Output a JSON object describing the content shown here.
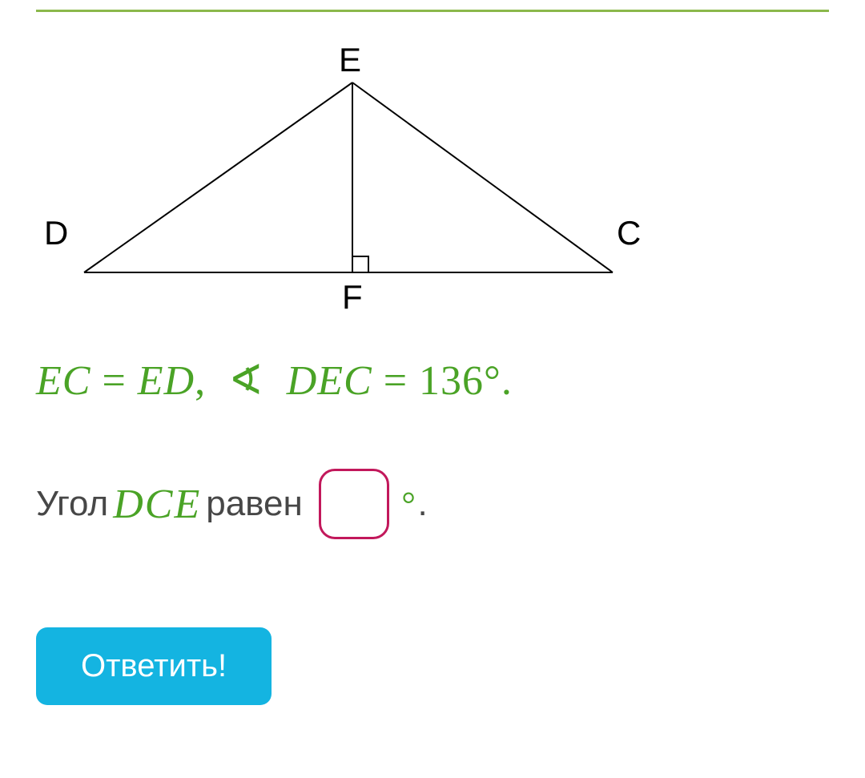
{
  "diagram": {
    "labels": {
      "E": "E",
      "D": "D",
      "C": "C",
      "F": "F"
    }
  },
  "given": {
    "seg1": "EC",
    "eq1": "=",
    "seg2": "ED",
    "comma": ",",
    "angle_sym": "∢",
    "angle_name": "DEC",
    "eq2": "=",
    "angle_val": "136",
    "deg": "°",
    "period": "."
  },
  "question": {
    "word_angle": "Угол",
    "var": "DCE",
    "word_equals": "равен",
    "deg": "°",
    "period": "."
  },
  "buttons": {
    "submit": "Ответить!"
  }
}
